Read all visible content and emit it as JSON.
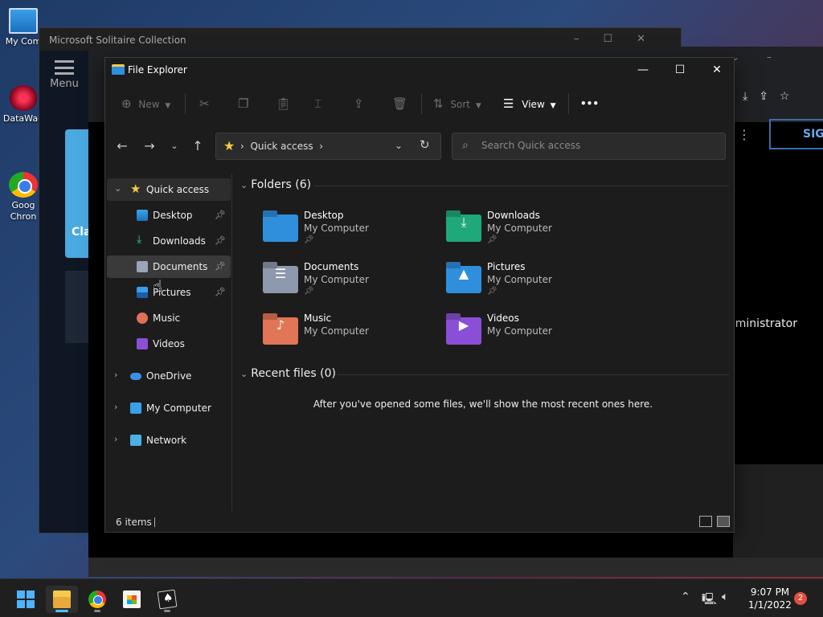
{
  "desktop": {
    "icons": [
      {
        "label": "My Com"
      },
      {
        "label": "DataWag"
      },
      {
        "label": "Goog Chron"
      }
    ]
  },
  "solitaire": {
    "title": "Microsoft Solitaire Collection",
    "menu_label": "Menu",
    "card_text": "Cla"
  },
  "browser": {
    "sign_in": "SIG",
    "admin_text": "dministrator"
  },
  "explorer": {
    "title": "File Explorer",
    "toolbar": {
      "new_label": "New",
      "sort_label": "Sort",
      "view_label": "View",
      "more": "•••"
    },
    "address": {
      "crumb": "Quick access"
    },
    "search": {
      "placeholder": "Search Quick access"
    },
    "nav": {
      "quick_access": "Quick access",
      "desktop": "Desktop",
      "downloads": "Downloads",
      "documents": "Documents",
      "pictures": "Pictures",
      "music": "Music",
      "videos": "Videos",
      "onedrive": "OneDrive",
      "my_computer": "My Computer",
      "network": "Network"
    },
    "folders_header": "Folders (6)",
    "folders": [
      {
        "name": "Desktop",
        "location": "My Computer",
        "color": "#2f8fdc"
      },
      {
        "name": "Downloads",
        "location": "My Computer",
        "color": "#1fa87a"
      },
      {
        "name": "Documents",
        "location": "My Computer",
        "color": "#8e99ad"
      },
      {
        "name": "Pictures",
        "location": "My Computer",
        "color": "#2f8fdc"
      },
      {
        "name": "Music",
        "location": "My Computer",
        "color": "#e07656"
      },
      {
        "name": "Videos",
        "location": "My Computer",
        "color": "#8a4fd6"
      }
    ],
    "recent_header": "Recent files (0)",
    "recent_empty": "After you've opened some files, we'll show the most recent ones here.",
    "status_count": "6 items"
  },
  "taskbar": {
    "time": "9:07 PM",
    "date": "1/1/2022",
    "notifications": "2"
  }
}
